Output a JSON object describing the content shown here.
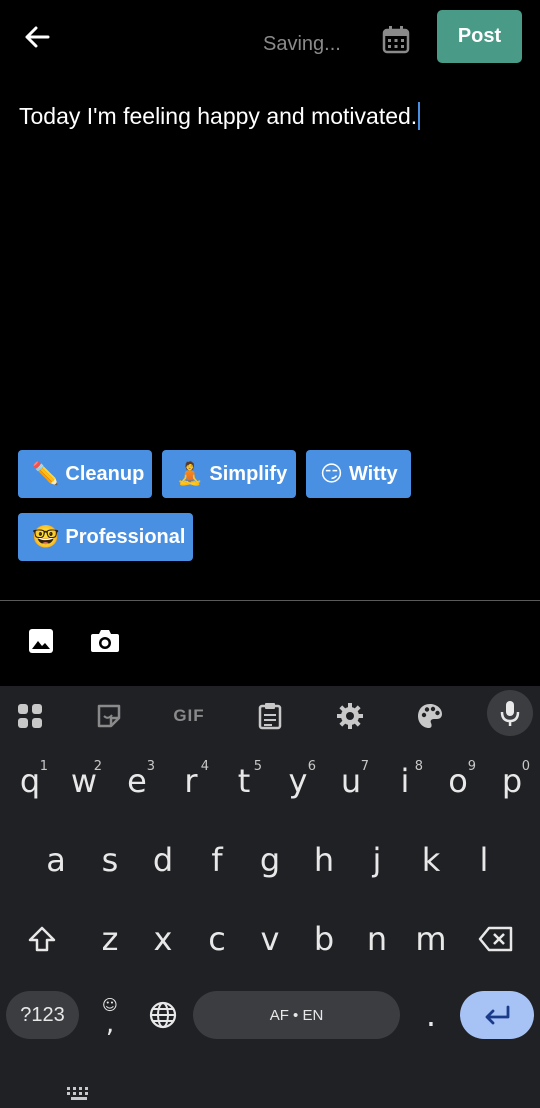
{
  "header": {
    "status": "Saving...",
    "post_label": "Post"
  },
  "editor": {
    "text": "Today I'm feeling happy and motivated."
  },
  "suggestions": [
    {
      "emoji": "✏️",
      "label": "Cleanup"
    },
    {
      "emoji": "🧘",
      "label": "Simplify"
    },
    {
      "emoji": "😏",
      "label": "Witty"
    },
    {
      "emoji": "🤓",
      "label": "Professional"
    }
  ],
  "keyboard": {
    "row1": [
      {
        "key": "q",
        "hint": "1"
      },
      {
        "key": "w",
        "hint": "2"
      },
      {
        "key": "e",
        "hint": "3"
      },
      {
        "key": "r",
        "hint": "4"
      },
      {
        "key": "t",
        "hint": "5"
      },
      {
        "key": "y",
        "hint": "6"
      },
      {
        "key": "u",
        "hint": "7"
      },
      {
        "key": "i",
        "hint": "8"
      },
      {
        "key": "o",
        "hint": "9"
      },
      {
        "key": "p",
        "hint": "0"
      }
    ],
    "row2": [
      "a",
      "s",
      "d",
      "f",
      "g",
      "h",
      "j",
      "k",
      "l"
    ],
    "row3": [
      "z",
      "x",
      "c",
      "v",
      "b",
      "n",
      "m"
    ],
    "symbols_label": "?123",
    "comma": ",",
    "space_label": "AF • EN",
    "period": ".",
    "gif_label": "GIF"
  },
  "icons": {
    "back": "arrow-left-icon",
    "calendar": "calendar-icon",
    "image": "image-icon",
    "camera": "camera-icon"
  }
}
